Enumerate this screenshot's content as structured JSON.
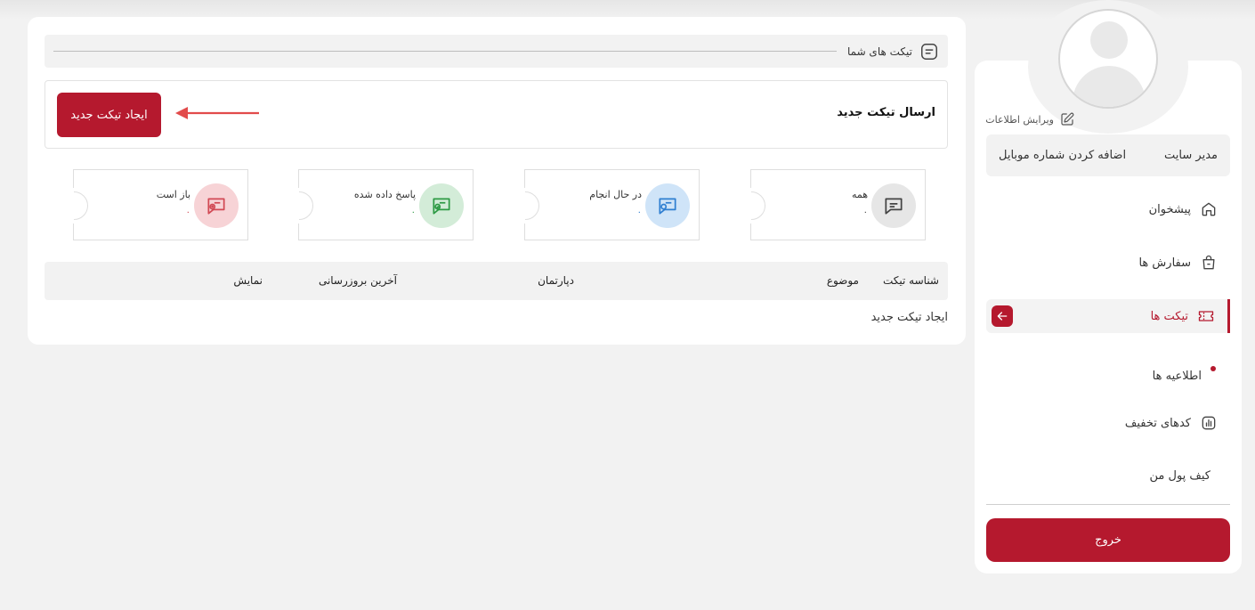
{
  "sidebar": {
    "edit_info": "ویرایش اطلاعات",
    "user_role": "مدیر سایت",
    "add_mobile": "اضافه کردن شماره موبایل",
    "nav": {
      "dashboard": "پیشخوان",
      "orders": "سفارش ها",
      "tickets": "تیکت ها",
      "notices": "اطلاعیه ها",
      "discounts": "کدهای تخفیف",
      "wallet": "کیف پول من"
    },
    "logout": "خروج"
  },
  "main": {
    "header_title": "تیکت های شما",
    "new_ticket_title": "ارسال تیکت جدید",
    "create_button": "ایجاد تیکت جدید",
    "stats": [
      {
        "label": "همه",
        "count": "۰",
        "color": "#444444",
        "bg": "#e6e6e6",
        "icon": "chat-icon"
      },
      {
        "label": "در حال انجام",
        "count": "۰",
        "color": "#2f7fd1",
        "bg": "#cfe4f8",
        "icon": "chat-clock-icon"
      },
      {
        "label": "پاسخ داده شده",
        "count": "۰",
        "color": "#2e9a45",
        "bg": "#d3ecd8",
        "icon": "chat-check-icon"
      },
      {
        "label": "باز است",
        "count": "۰",
        "color": "#d24a55",
        "bg": "#f7d3d6",
        "icon": "chat-open-icon"
      }
    ],
    "table_headers": {
      "id": "شناسه تیکت",
      "subject": "موضوع",
      "department": "دپارتمان",
      "updated": "آخرین بروزرسانی",
      "view": "نمایش"
    },
    "empty_link": "ایجاد تیکت جدید"
  },
  "colors": {
    "accent": "#b5192e",
    "page_bg": "#f2f2f2"
  }
}
